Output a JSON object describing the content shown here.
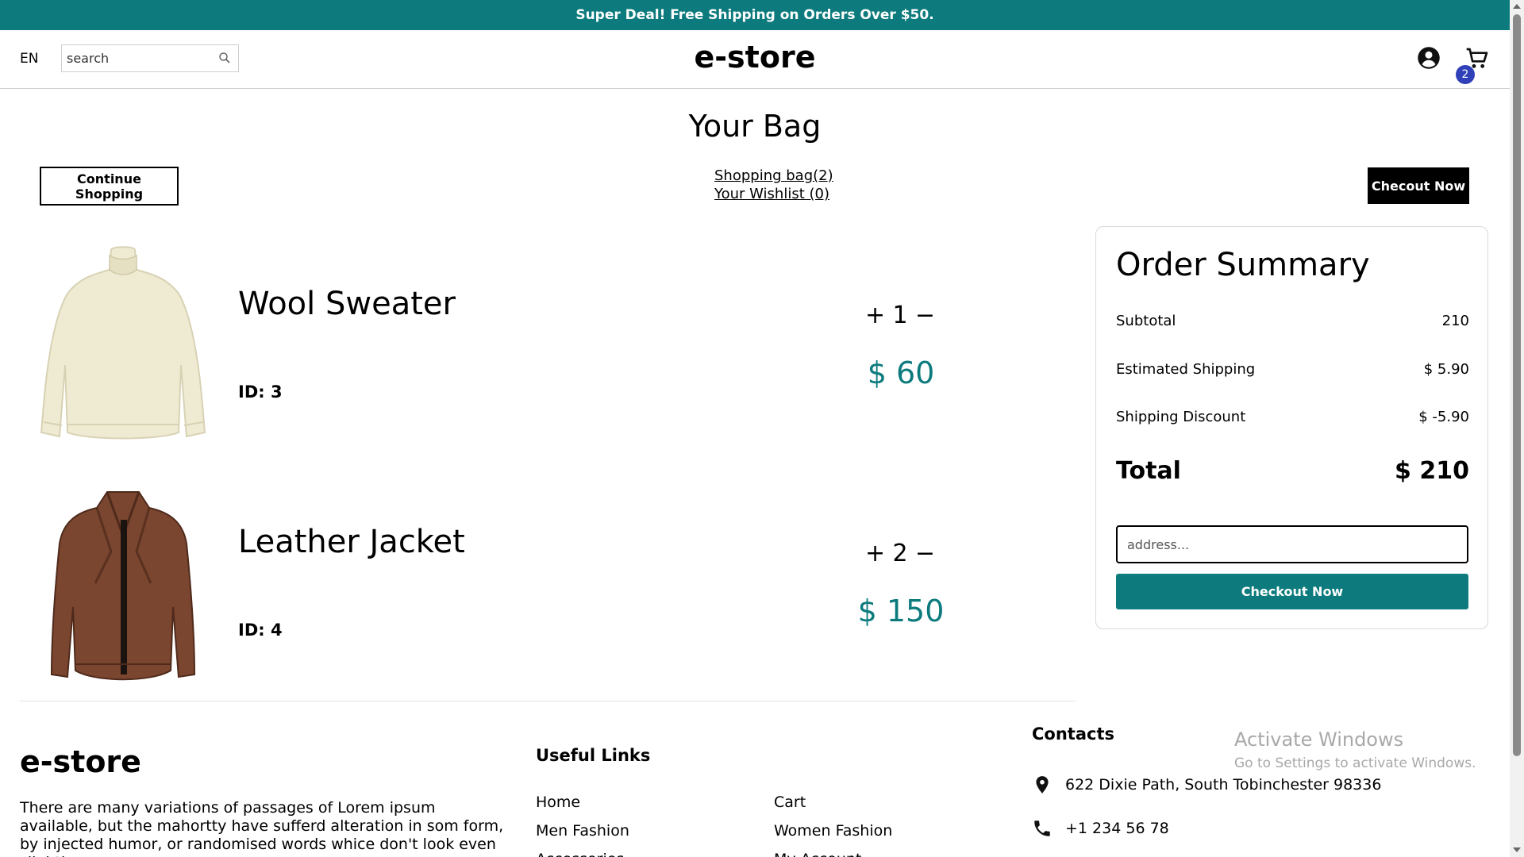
{
  "announcement": "Super Deal! Free Shipping on Orders Over $50.",
  "header": {
    "language": "EN",
    "search_placeholder": "search",
    "brand": "e-store",
    "cart_count": "2"
  },
  "page": {
    "title": "Your Bag",
    "continue_label": "Continue Shopping",
    "bag_link": "Shopping bag(2)",
    "wishlist_link": "Your Wishlist (0)",
    "checkout_top_label": "Checout Now"
  },
  "products": [
    {
      "name": "Wool Sweater",
      "id": "ID: 3",
      "qty": "1",
      "price": "$ 60"
    },
    {
      "name": "Leather Jacket",
      "id": "ID: 4",
      "qty": "2",
      "price": "$ 150"
    }
  ],
  "qty_controls": {
    "plus": "+",
    "minus": "−"
  },
  "summary": {
    "title": "Order Summary",
    "subtotal_label": "Subtotal",
    "subtotal_value": "210",
    "shipping_label": "Estimated Shipping",
    "shipping_value": "$ 5.90",
    "discount_label": "Shipping Discount",
    "discount_value": "$ -5.90",
    "total_label": "Total",
    "total_value": "$ 210",
    "address_placeholder": "address...",
    "checkout_label": "Checkout Now"
  },
  "footer": {
    "brand": "e-store",
    "description": "There are many variations of passages of Lorem ipsum available, but the mahortty have sufferd alteration in som form, by injected humor, or randomised words whice don't look even slightly",
    "links_title": "Useful Links",
    "links_col1": [
      "Home",
      "Men Fashion",
      "Accessories"
    ],
    "links_col2": [
      "Cart",
      "Women Fashion",
      "My Account"
    ],
    "contacts_title": "Contacts",
    "address": "622 Dixie Path, South Tobinchester 98336",
    "phone": "+1 234 56 78"
  },
  "watermark": {
    "line1": "Activate Windows",
    "line2": "Go to Settings to activate Windows."
  },
  "colors": {
    "accent": "#0d7b7d",
    "badge": "#3040b8"
  }
}
